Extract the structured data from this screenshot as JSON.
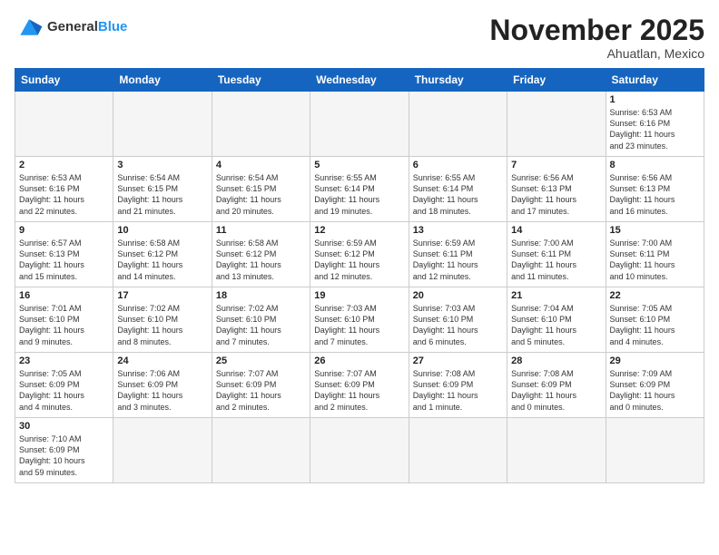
{
  "header": {
    "logo_general": "General",
    "logo_blue": "Blue",
    "month_title": "November 2025",
    "location": "Ahuatlan, Mexico"
  },
  "days_of_week": [
    "Sunday",
    "Monday",
    "Tuesday",
    "Wednesday",
    "Thursday",
    "Friday",
    "Saturday"
  ],
  "weeks": [
    [
      {
        "num": "",
        "info": ""
      },
      {
        "num": "",
        "info": ""
      },
      {
        "num": "",
        "info": ""
      },
      {
        "num": "",
        "info": ""
      },
      {
        "num": "",
        "info": ""
      },
      {
        "num": "",
        "info": ""
      },
      {
        "num": "1",
        "info": "Sunrise: 6:53 AM\nSunset: 6:16 PM\nDaylight: 11 hours\nand 23 minutes."
      }
    ],
    [
      {
        "num": "2",
        "info": "Sunrise: 6:53 AM\nSunset: 6:16 PM\nDaylight: 11 hours\nand 22 minutes."
      },
      {
        "num": "3",
        "info": "Sunrise: 6:54 AM\nSunset: 6:15 PM\nDaylight: 11 hours\nand 21 minutes."
      },
      {
        "num": "4",
        "info": "Sunrise: 6:54 AM\nSunset: 6:15 PM\nDaylight: 11 hours\nand 20 minutes."
      },
      {
        "num": "5",
        "info": "Sunrise: 6:55 AM\nSunset: 6:14 PM\nDaylight: 11 hours\nand 19 minutes."
      },
      {
        "num": "6",
        "info": "Sunrise: 6:55 AM\nSunset: 6:14 PM\nDaylight: 11 hours\nand 18 minutes."
      },
      {
        "num": "7",
        "info": "Sunrise: 6:56 AM\nSunset: 6:13 PM\nDaylight: 11 hours\nand 17 minutes."
      },
      {
        "num": "8",
        "info": "Sunrise: 6:56 AM\nSunset: 6:13 PM\nDaylight: 11 hours\nand 16 minutes."
      }
    ],
    [
      {
        "num": "9",
        "info": "Sunrise: 6:57 AM\nSunset: 6:13 PM\nDaylight: 11 hours\nand 15 minutes."
      },
      {
        "num": "10",
        "info": "Sunrise: 6:58 AM\nSunset: 6:12 PM\nDaylight: 11 hours\nand 14 minutes."
      },
      {
        "num": "11",
        "info": "Sunrise: 6:58 AM\nSunset: 6:12 PM\nDaylight: 11 hours\nand 13 minutes."
      },
      {
        "num": "12",
        "info": "Sunrise: 6:59 AM\nSunset: 6:12 PM\nDaylight: 11 hours\nand 12 minutes."
      },
      {
        "num": "13",
        "info": "Sunrise: 6:59 AM\nSunset: 6:11 PM\nDaylight: 11 hours\nand 12 minutes."
      },
      {
        "num": "14",
        "info": "Sunrise: 7:00 AM\nSunset: 6:11 PM\nDaylight: 11 hours\nand 11 minutes."
      },
      {
        "num": "15",
        "info": "Sunrise: 7:00 AM\nSunset: 6:11 PM\nDaylight: 11 hours\nand 10 minutes."
      }
    ],
    [
      {
        "num": "16",
        "info": "Sunrise: 7:01 AM\nSunset: 6:10 PM\nDaylight: 11 hours\nand 9 minutes."
      },
      {
        "num": "17",
        "info": "Sunrise: 7:02 AM\nSunset: 6:10 PM\nDaylight: 11 hours\nand 8 minutes."
      },
      {
        "num": "18",
        "info": "Sunrise: 7:02 AM\nSunset: 6:10 PM\nDaylight: 11 hours\nand 7 minutes."
      },
      {
        "num": "19",
        "info": "Sunrise: 7:03 AM\nSunset: 6:10 PM\nDaylight: 11 hours\nand 7 minutes."
      },
      {
        "num": "20",
        "info": "Sunrise: 7:03 AM\nSunset: 6:10 PM\nDaylight: 11 hours\nand 6 minutes."
      },
      {
        "num": "21",
        "info": "Sunrise: 7:04 AM\nSunset: 6:10 PM\nDaylight: 11 hours\nand 5 minutes."
      },
      {
        "num": "22",
        "info": "Sunrise: 7:05 AM\nSunset: 6:10 PM\nDaylight: 11 hours\nand 4 minutes."
      }
    ],
    [
      {
        "num": "23",
        "info": "Sunrise: 7:05 AM\nSunset: 6:09 PM\nDaylight: 11 hours\nand 4 minutes."
      },
      {
        "num": "24",
        "info": "Sunrise: 7:06 AM\nSunset: 6:09 PM\nDaylight: 11 hours\nand 3 minutes."
      },
      {
        "num": "25",
        "info": "Sunrise: 7:07 AM\nSunset: 6:09 PM\nDaylight: 11 hours\nand 2 minutes."
      },
      {
        "num": "26",
        "info": "Sunrise: 7:07 AM\nSunset: 6:09 PM\nDaylight: 11 hours\nand 2 minutes."
      },
      {
        "num": "27",
        "info": "Sunrise: 7:08 AM\nSunset: 6:09 PM\nDaylight: 11 hours\nand 1 minute."
      },
      {
        "num": "28",
        "info": "Sunrise: 7:08 AM\nSunset: 6:09 PM\nDaylight: 11 hours\nand 0 minutes."
      },
      {
        "num": "29",
        "info": "Sunrise: 7:09 AM\nSunset: 6:09 PM\nDaylight: 11 hours\nand 0 minutes."
      }
    ],
    [
      {
        "num": "30",
        "info": "Sunrise: 7:10 AM\nSunset: 6:09 PM\nDaylight: 10 hours\nand 59 minutes."
      },
      {
        "num": "",
        "info": ""
      },
      {
        "num": "",
        "info": ""
      },
      {
        "num": "",
        "info": ""
      },
      {
        "num": "",
        "info": ""
      },
      {
        "num": "",
        "info": ""
      },
      {
        "num": "",
        "info": ""
      }
    ]
  ]
}
